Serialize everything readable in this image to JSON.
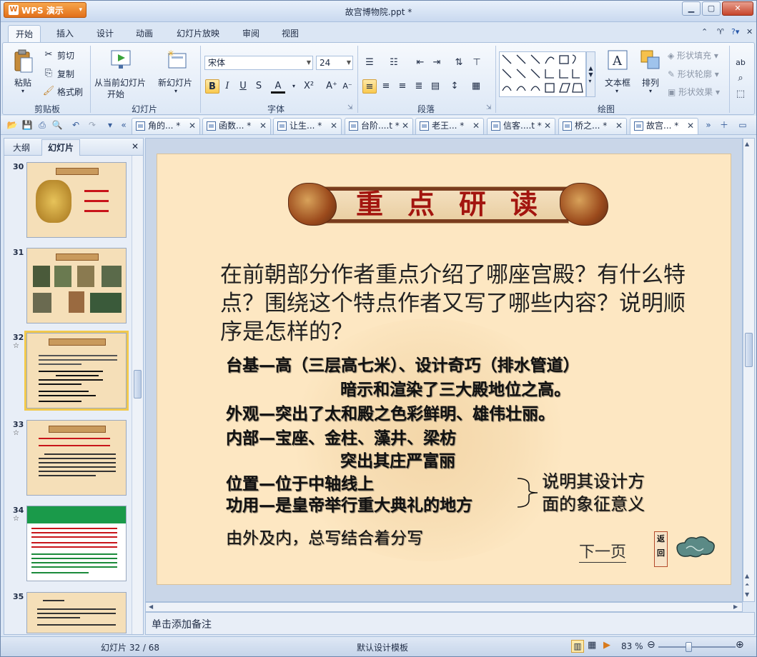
{
  "app": {
    "name": "WPS 演示",
    "window_title": "故宫博物院.ppt *"
  },
  "ribbon_tabs": [
    "开始",
    "插入",
    "设计",
    "动画",
    "幻灯片放映",
    "审阅",
    "视图"
  ],
  "ribbon": {
    "paste": "粘贴",
    "cut": "剪切",
    "copy": "复制",
    "format_painter": "格式刷",
    "clipboard_group": "剪贴板",
    "from_current": "从当前幻灯片",
    "start": "开始",
    "new_slide": "新幻灯片",
    "slides_group": "幻灯片",
    "font_name": "宋体",
    "font_size": "24",
    "font_group": "字体",
    "paragraph_group": "段落",
    "textbox": "文本框",
    "arrange": "排列",
    "shape_fill": "形状填充",
    "shape_outline": "形状轮廓",
    "shape_effect": "形状效果",
    "drawing_group": "绘图"
  },
  "doc_tabs": [
    {
      "label": "角的... *"
    },
    {
      "label": "函数... *"
    },
    {
      "label": "让生... *"
    },
    {
      "label": "台阶....t *"
    },
    {
      "label": "老王... *"
    },
    {
      "label": "信客....t *"
    },
    {
      "label": "桥之... *"
    },
    {
      "label": "故宫... *"
    }
  ],
  "left_panel": {
    "tab_outline": "大纲",
    "tab_slides": "幻灯片",
    "thumbs": [
      {
        "num": "30"
      },
      {
        "num": "31"
      },
      {
        "num": "32",
        "star": "☆"
      },
      {
        "num": "33",
        "star": "☆"
      },
      {
        "num": "34",
        "star": "☆"
      },
      {
        "num": "35"
      }
    ]
  },
  "slide": {
    "banner_title": "重点研读",
    "question": "在前朝部分作者重点介绍了哪座宫殿？有什么特点？围绕这个特点作者又写了哪些内容？说明顺序是怎样的？",
    "line1": "台基—高（三层高七米）、设计奇巧（排水管道）",
    "line1b": "暗示和渲染了三大殿地位之高。",
    "line2": "外观—突出了太和殿之色彩鲜明、雄伟壮丽。",
    "line3": "内部—宝座、金柱、藻井、梁枋",
    "line3b": "突出其庄严富丽",
    "line4": "位置—位于中轴线上",
    "line5": "功用—是皇帝举行重大典礼的地方",
    "side_note_1": "说明其设计方",
    "side_note_2": "面的象征意义",
    "summary": "由外及内，总写结合着分写",
    "next_link": "下一页",
    "back_1": "返",
    "back_2": "回"
  },
  "notes_placeholder": "单击添加备注",
  "status": {
    "slide_counter": "幻灯片 32 / 68",
    "template": "默认设计模板",
    "zoom": "83 %"
  }
}
